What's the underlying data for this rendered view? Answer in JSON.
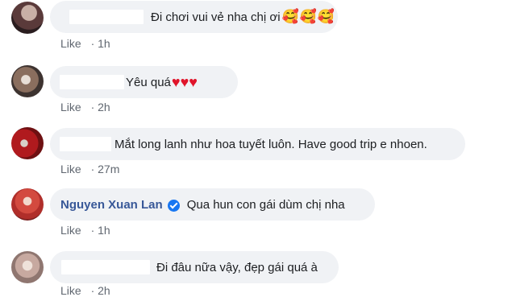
{
  "colors": {
    "bubble": "#f0f2f5",
    "name_link": "#385898",
    "meta_text": "#606770",
    "verified": "#1877f2",
    "heart": "#e0142a"
  },
  "comments": [
    {
      "text": "Đi chơi vui vẻ nha chị ơi",
      "emoji": "🥰🥰🥰",
      "like": "Like",
      "dot": "·",
      "time": "1h"
    },
    {
      "text": "Yêu quá",
      "emoji": "♥♥♥",
      "like": "Like",
      "dot": "·",
      "time": "2h"
    },
    {
      "text": "Mắt long lanh như hoa tuyết luôn. Have good trip e nhoen.",
      "like": "Like",
      "dot": "·",
      "time": "27m"
    },
    {
      "name": "Nguyen Xuan Lan",
      "text": "Qua hun con gái dùm chị nha",
      "like": "Like",
      "dot": "·",
      "time": "1h"
    },
    {
      "text": "Đi đâu nữa vậy, đẹp gái quá à",
      "like": "Like",
      "dot": "·",
      "time": "2h"
    }
  ]
}
